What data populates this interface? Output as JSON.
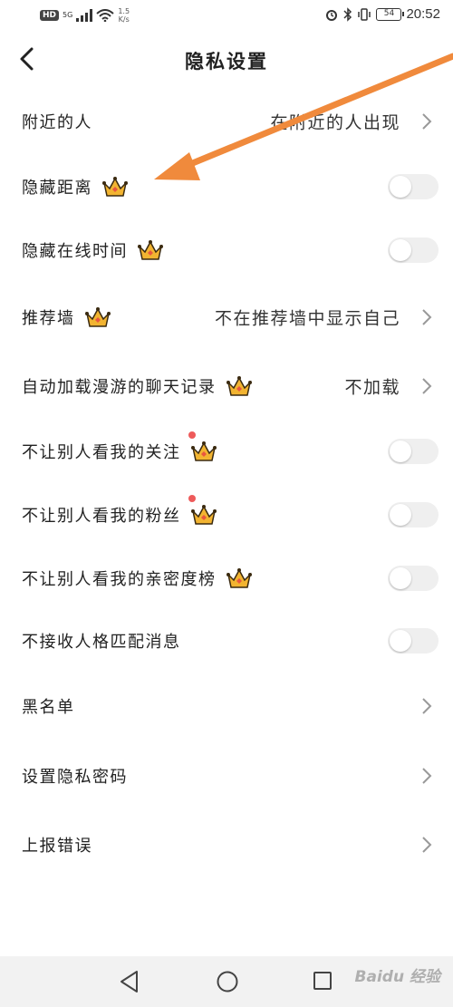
{
  "status_bar": {
    "hd": "HD",
    "network": "5G",
    "speed_value": "1.5",
    "speed_unit": "K/s",
    "battery": "54",
    "time": "20:52"
  },
  "header": {
    "title": "隐私设置"
  },
  "rows": [
    {
      "label": "附近的人",
      "value": "在附近的人出现",
      "control": "chevron",
      "crown": false
    },
    {
      "label": "隐藏距离",
      "control": "toggle",
      "toggle_on": false,
      "crown": true
    },
    {
      "label": "隐藏在线时间",
      "control": "toggle",
      "toggle_on": false,
      "crown": true
    },
    {
      "label": "推荐墙",
      "value": "不在推荐墙中显示自己",
      "control": "chevron",
      "crown": true
    },
    {
      "label": "自动加载漫游的聊天记录",
      "value": "不加载",
      "control": "chevron",
      "crown": true
    },
    {
      "label": "不让别人看我的关注",
      "control": "toggle",
      "toggle_on": false,
      "crown": true,
      "red_dot": true
    },
    {
      "label": "不让别人看我的粉丝",
      "control": "toggle",
      "toggle_on": false,
      "crown": true,
      "red_dot": true
    },
    {
      "label": "不让别人看我的亲密度榜",
      "control": "toggle",
      "toggle_on": false,
      "crown": true
    },
    {
      "label": "不接收人格匹配消息",
      "control": "toggle",
      "toggle_on": false,
      "crown": false
    },
    {
      "label": "黑名单",
      "control": "chevron",
      "crown": false
    },
    {
      "label": "设置隐私密码",
      "control": "chevron",
      "crown": false
    },
    {
      "label": "上报错误",
      "control": "chevron",
      "crown": false
    }
  ],
  "watermark": "Baidu 经验",
  "colors": {
    "crown": "#f2b431",
    "annotation_arrow": "#f08a3c",
    "red_dot": "#ee5a5a",
    "toggle_off": "#efefef"
  },
  "icons": [
    "back-icon",
    "chevron-right-icon",
    "crown-icon",
    "nav-back-icon",
    "nav-home-icon",
    "nav-recent-icon"
  ]
}
